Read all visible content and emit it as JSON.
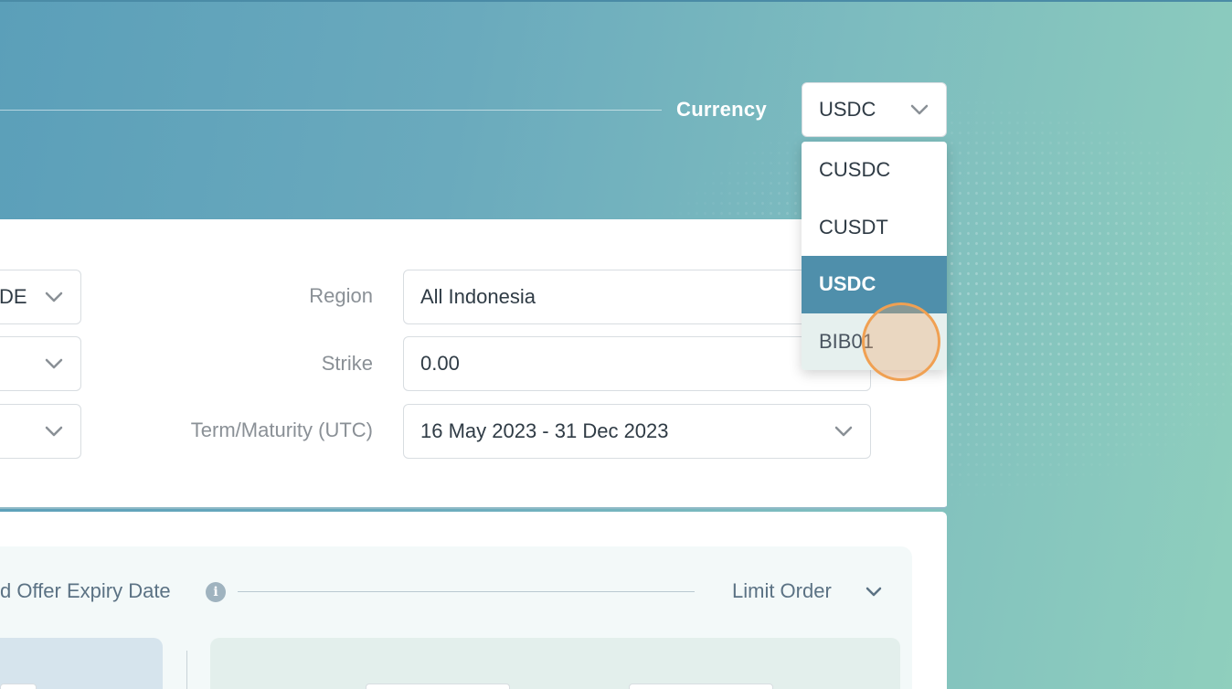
{
  "header": {
    "currency_label": "Currency",
    "currency_value": "USDC"
  },
  "currency_options": [
    {
      "label": "CUSDC",
      "state": "normal"
    },
    {
      "label": "CUSDT",
      "state": "normal"
    },
    {
      "label": "USDC",
      "state": "selected"
    },
    {
      "label": "BIB01",
      "state": "hover"
    }
  ],
  "filters": {
    "left_select_partial": "DE",
    "region_label": "Region",
    "region_value": "All Indonesia",
    "strike_label": "Strike",
    "strike_value": "0.00",
    "term_label": "Term/Maturity (UTC)",
    "term_value": "16 May 2023 - 31 Dec 2023"
  },
  "offer": {
    "expiry_label_partial": "d Offer Expiry Date",
    "info_icon": "i",
    "order_type": "Limit Order"
  },
  "colors": {
    "selected_option": "#4f8fab",
    "hover_option": "#e6f0ee",
    "cursor_ring": "#f0a052"
  }
}
